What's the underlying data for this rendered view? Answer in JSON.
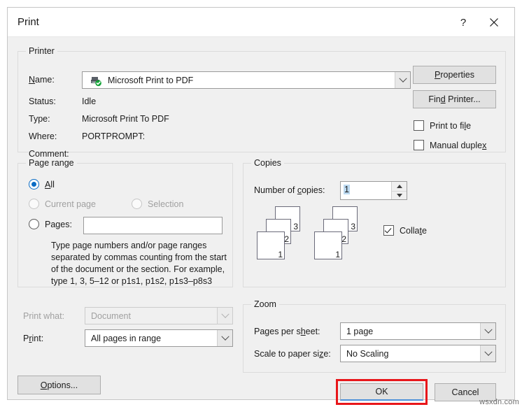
{
  "dialog": {
    "title": "Print",
    "help_icon": "question-mark-icon",
    "close_icon": "close-x-icon"
  },
  "printer": {
    "group_label": "Printer",
    "name_label": "Name:",
    "name_label_parts": {
      "pre": "",
      "accel": "N",
      "post": "ame:"
    },
    "name_value": "Microsoft Print to PDF",
    "name_icon": "printer-default-icon",
    "status_label": "Status:",
    "status_value": "Idle",
    "type_label": "Type:",
    "type_value": "Microsoft Print To PDF",
    "where_label": "Where:",
    "where_value": "PORTPROMPT:",
    "comment_label": "Comment:",
    "comment_value": "",
    "properties_button": "Properties",
    "properties_accel": "P",
    "find_printer_button": "Find Printer...",
    "print_to_file_label": "Print to file",
    "print_to_file_checked": false,
    "manual_duplex_label": "Manual duplex",
    "manual_duplex_checked": false
  },
  "page_range": {
    "group_label": "Page range",
    "options": [
      {
        "label": "All",
        "selected": true,
        "disabled": false
      },
      {
        "label": "Current page",
        "selected": false,
        "disabled": true
      },
      {
        "label": "Selection",
        "selected": false,
        "disabled": true
      },
      {
        "label": "Pages:",
        "selected": false,
        "disabled": false
      }
    ],
    "pages_value": "",
    "help_text": "Type page numbers and/or page ranges separated by commas counting from the start of the document or the section. For example, type 1, 3, 5–12 or p1s1, p1s2, p1s3–p8s3"
  },
  "copies": {
    "group_label": "Copies",
    "number_label": "Number of copies:",
    "number_value": "1",
    "spin_up_icon": "spinner-up-icon",
    "spin_down_icon": "spinner-down-icon",
    "collate_label": "Collate",
    "collate_checked": true,
    "stack_page_numbers": [
      "3",
      "2",
      "1"
    ]
  },
  "print_what": {
    "label": "Print what:",
    "value": "Document",
    "disabled": true
  },
  "print_range": {
    "label": "Print:",
    "value": "All pages in range",
    "disabled": false
  },
  "zoom": {
    "group_label": "Zoom",
    "pages_per_sheet_label": "Pages per sheet:",
    "pages_per_sheet_value": "1 page",
    "scale_label": "Scale to paper size:",
    "scale_value": "No Scaling"
  },
  "footer": {
    "options_button": "Options...",
    "ok_button": "OK",
    "cancel_button": "Cancel",
    "ok_highlighted": true,
    "highlight_color": "#e8161a"
  },
  "watermark": "wsxdn.com"
}
